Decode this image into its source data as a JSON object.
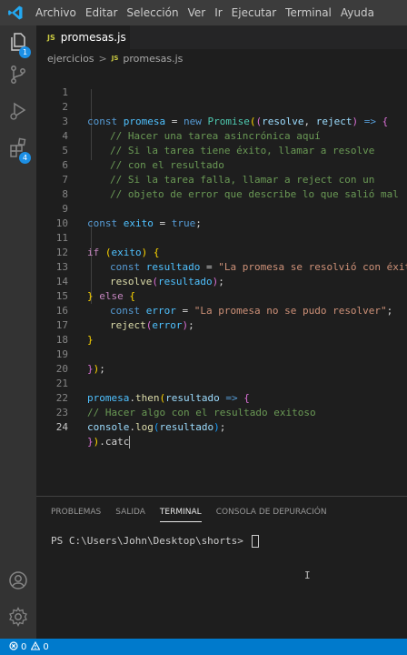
{
  "menu": [
    "Archivo",
    "Editar",
    "Selección",
    "Ver",
    "Ir",
    "Ejecutar",
    "Terminal",
    "Ayuda"
  ],
  "activity_badges": {
    "explorer": "1",
    "extensions": "4"
  },
  "tab": {
    "icon": "JS",
    "label": "promesas.js"
  },
  "breadcrumb": {
    "folder": "ejercicios",
    "sep": ">",
    "icon": "JS",
    "file": "promesas.js"
  },
  "editor": {
    "active_line": 24,
    "lines": [
      {
        "n": "1"
      },
      {
        "n": "2"
      },
      {
        "n": "3"
      },
      {
        "n": "4"
      },
      {
        "n": "5"
      },
      {
        "n": "6"
      },
      {
        "n": "7"
      },
      {
        "n": "8"
      },
      {
        "n": "9"
      },
      {
        "n": "10"
      },
      {
        "n": "11"
      },
      {
        "n": "12"
      },
      {
        "n": "13"
      },
      {
        "n": "14"
      },
      {
        "n": "15"
      },
      {
        "n": "16"
      },
      {
        "n": "17"
      },
      {
        "n": "18"
      },
      {
        "n": "19"
      },
      {
        "n": "20"
      },
      {
        "n": "21"
      },
      {
        "n": "22"
      },
      {
        "n": "23"
      },
      {
        "n": "24"
      }
    ],
    "code": {
      "l2": [
        "const",
        " ",
        "promesa",
        " = ",
        "new",
        " ",
        "Promise",
        "(",
        "(",
        "resolve",
        ", ",
        "reject",
        ")",
        " => ",
        "{"
      ],
      "l3": "// Hacer una tarea asincrónica aquí",
      "l4": "// Si la tarea tiene éxito, llamar a resolve",
      "l5": "// con el resultado",
      "l6": "// Si la tarea falla, llamar a reject con un",
      "l7": "// objeto de error que describe lo que salió mal",
      "l9": [
        "const",
        " ",
        "exito",
        " = ",
        "true",
        ";"
      ],
      "l11": [
        "if",
        " ",
        "(",
        "exito",
        ")",
        " ",
        "{"
      ],
      "l12": [
        "const",
        " ",
        "resultado",
        " = ",
        "\"La promesa se resolvió con éxito\""
      ],
      "l13": [
        "resolve",
        "(",
        "resultado",
        ")",
        ";"
      ],
      "l14": [
        "}",
        " ",
        "else",
        " ",
        "{"
      ],
      "l15": [
        "const",
        " ",
        "error",
        " = ",
        "\"La promesa no se pudo resolver\"",
        ";"
      ],
      "l16": [
        "reject",
        "(",
        "error",
        ")",
        ";"
      ],
      "l17": [
        "}"
      ],
      "l19": [
        "}",
        ")",
        ";"
      ],
      "l21": [
        "promesa",
        ".",
        "then",
        "(",
        "resultado",
        " => ",
        "{"
      ],
      "l22": "// Hacer algo con el resultado exitoso",
      "l23": [
        "console",
        ".",
        "log",
        "(",
        "resultado",
        ")",
        ";"
      ],
      "l24": [
        "}",
        ")",
        ".catc"
      ]
    }
  },
  "panel": {
    "tabs": [
      "PROBLEMAS",
      "SALIDA",
      "TERMINAL",
      "CONSOLA DE DEPURACIÓN"
    ],
    "active_tab": "TERMINAL",
    "prompt": "PS C:\\Users\\John\\Desktop\\shorts> "
  },
  "status": {
    "errors": "0",
    "warnings": "0"
  },
  "colors": {
    "statusbar": "#007acc",
    "menubar": "#3c3c3c",
    "activitybar": "#333333",
    "editor_bg": "#1e1e1e"
  }
}
